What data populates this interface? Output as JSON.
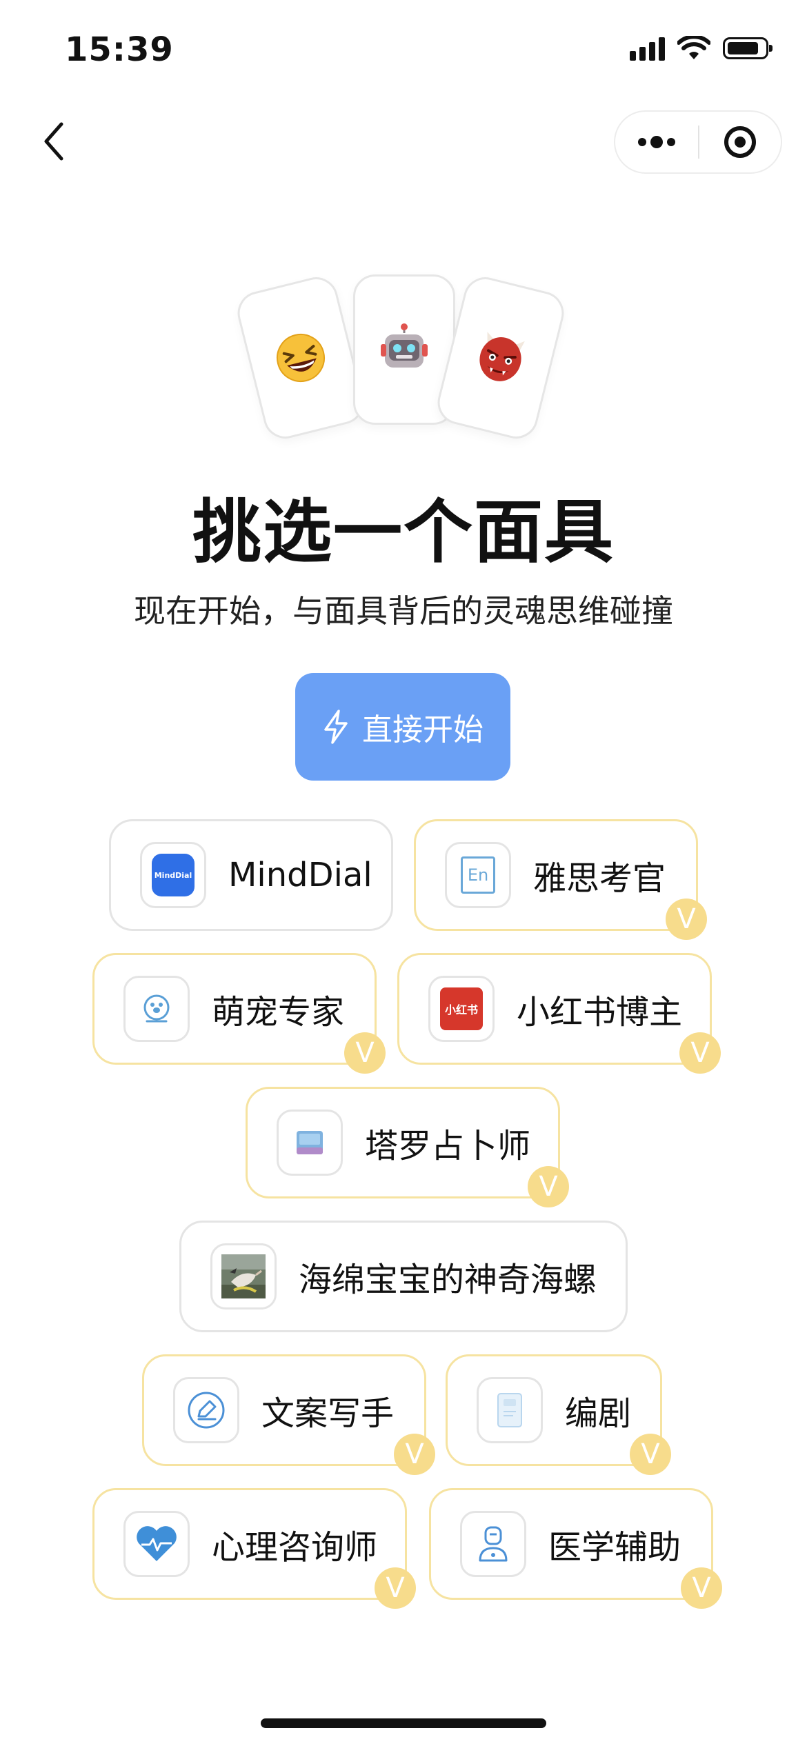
{
  "status_bar": {
    "time": "15:39"
  },
  "nav": {
    "back_icon": "chevron-left-icon",
    "more_icon": "more-dots-icon",
    "close_icon": "target-icon"
  },
  "masks": [
    {
      "icon": "grinning-squint-face-emoji"
    },
    {
      "icon": "robot-face-emoji"
    },
    {
      "icon": "ogre-mask-emoji"
    }
  ],
  "title": "挑选一个面具",
  "subtitle": "现在开始，与面具背后的灵魂思维碰撞",
  "start_button": {
    "label": "直接开始",
    "icon": "lightning-icon",
    "color": "#6aa0f5"
  },
  "vip_badge": "V",
  "personas": [
    {
      "label": "MindDial",
      "icon": "minddial-logo",
      "vip": false,
      "icon_text": "MindDial"
    },
    {
      "label": "雅思考官",
      "icon": "en-icon",
      "vip": true,
      "icon_text": "En"
    },
    {
      "label": "萌宠专家",
      "icon": "pet-icon",
      "vip": true
    },
    {
      "label": "小红书博主",
      "icon": "xiaohongshu-logo",
      "vip": true,
      "icon_text": "小红书"
    },
    {
      "label": "塔罗占卜师",
      "icon": "tarot-card-icon",
      "vip": true
    },
    {
      "label": "海绵宝宝的神奇海螺",
      "icon": "magic-conch-image",
      "vip": false
    },
    {
      "label": "文案写手",
      "icon": "pen-icon",
      "vip": true
    },
    {
      "label": "编剧",
      "icon": "script-book-icon",
      "vip": true
    },
    {
      "label": "心理咨询师",
      "icon": "heart-pulse-icon",
      "vip": true
    },
    {
      "label": "医学辅助",
      "icon": "doctor-icon",
      "vip": true
    }
  ],
  "colors": {
    "accent": "#6aa0f5",
    "vip": "#f7dc8c",
    "vip_border": "#f6e3a1"
  }
}
